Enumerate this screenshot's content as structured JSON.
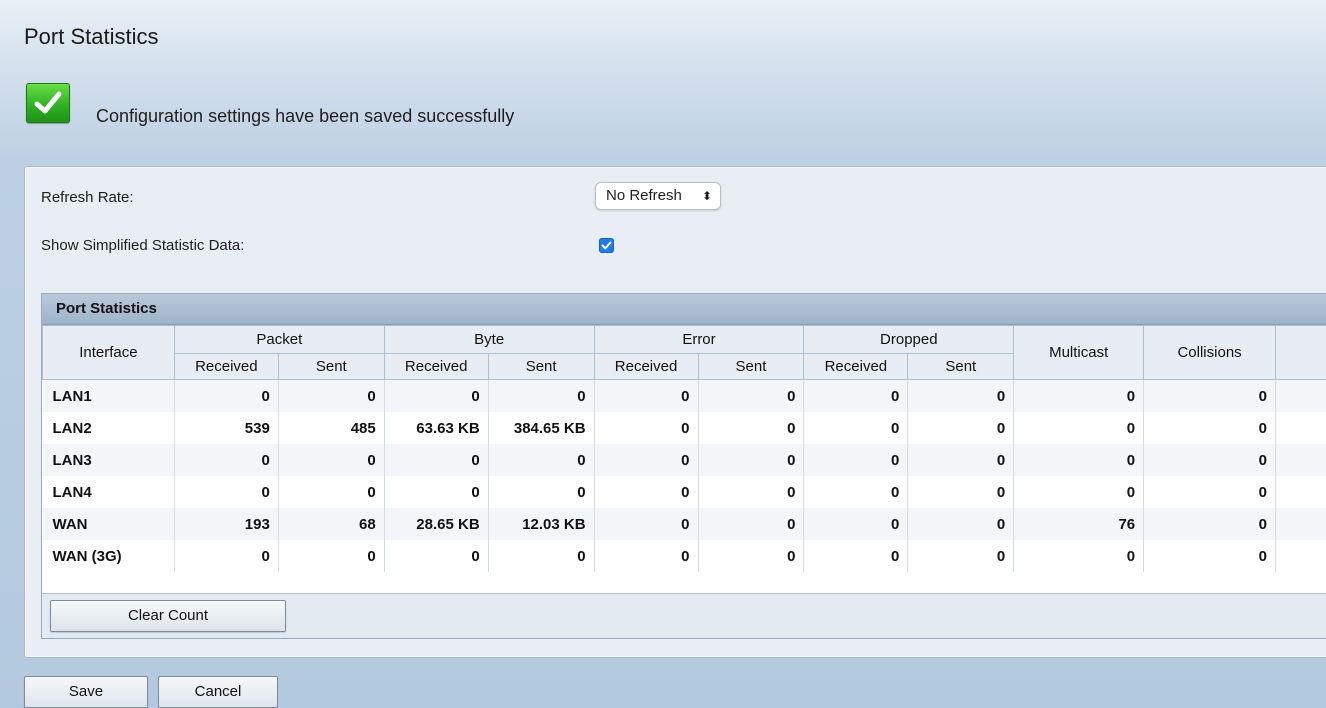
{
  "page": {
    "title": "Port Statistics",
    "success_message": "Configuration settings have been saved successfully"
  },
  "form": {
    "refresh_label": "Refresh Rate:",
    "refresh_value": "No Refresh",
    "simplified_label": "Show Simplified Statistic Data:",
    "simplified_checked": true
  },
  "table": {
    "title": "Port Statistics",
    "headers": {
      "interface": "Interface",
      "packet": "Packet",
      "byte": "Byte",
      "error": "Error",
      "dropped": "Dropped",
      "multicast": "Multicast",
      "collisions": "Collisions",
      "received": "Received",
      "sent": "Sent"
    },
    "rows": [
      {
        "interface": "LAN1",
        "packet_rx": "0",
        "packet_tx": "0",
        "byte_rx": "0",
        "byte_tx": "0",
        "error_rx": "0",
        "error_tx": "0",
        "dropped_rx": "0",
        "dropped_tx": "0",
        "multicast": "0",
        "collisions": "0"
      },
      {
        "interface": "LAN2",
        "packet_rx": "539",
        "packet_tx": "485",
        "byte_rx": "63.63 KB",
        "byte_tx": "384.65 KB",
        "error_rx": "0",
        "error_tx": "0",
        "dropped_rx": "0",
        "dropped_tx": "0",
        "multicast": "0",
        "collisions": "0"
      },
      {
        "interface": "LAN3",
        "packet_rx": "0",
        "packet_tx": "0",
        "byte_rx": "0",
        "byte_tx": "0",
        "error_rx": "0",
        "error_tx": "0",
        "dropped_rx": "0",
        "dropped_tx": "0",
        "multicast": "0",
        "collisions": "0"
      },
      {
        "interface": "LAN4",
        "packet_rx": "0",
        "packet_tx": "0",
        "byte_rx": "0",
        "byte_tx": "0",
        "error_rx": "0",
        "error_tx": "0",
        "dropped_rx": "0",
        "dropped_tx": "0",
        "multicast": "0",
        "collisions": "0"
      },
      {
        "interface": "WAN",
        "packet_rx": "193",
        "packet_tx": "68",
        "byte_rx": "28.65 KB",
        "byte_tx": "12.03 KB",
        "error_rx": "0",
        "error_tx": "0",
        "dropped_rx": "0",
        "dropped_tx": "0",
        "multicast": "76",
        "collisions": "0"
      },
      {
        "interface": "WAN (3G)",
        "packet_rx": "0",
        "packet_tx": "0",
        "byte_rx": "0",
        "byte_tx": "0",
        "error_rx": "0",
        "error_tx": "0",
        "dropped_rx": "0",
        "dropped_tx": "0",
        "multicast": "0",
        "collisions": "0"
      }
    ],
    "clear_button": "Clear Count"
  },
  "actions": {
    "save": "Save",
    "cancel": "Cancel"
  },
  "icons": {
    "success": "checkmark-icon",
    "select": "up-down-arrows-icon",
    "checkbox": "checkmark-icon"
  },
  "colors": {
    "success_green": "#2fb222",
    "checkbox_blue": "#1a7ee6",
    "table_header": "#b8c9da"
  }
}
